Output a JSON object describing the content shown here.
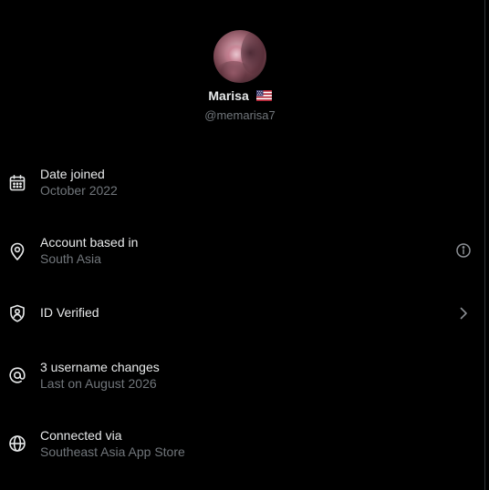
{
  "profile": {
    "name": "Marisa",
    "flag_emoji": "🇺🇸",
    "handle": "@memarisa7"
  },
  "rows": [
    {
      "title": "Date joined",
      "subtitle": "October 2022",
      "icon": "calendar-icon"
    },
    {
      "title": "Account based in",
      "subtitle": "South Asia",
      "icon": "location-pin-icon",
      "right_icon": "info-icon"
    },
    {
      "title": "ID Verified",
      "icon": "shield-user-icon",
      "right_icon": "chevron-right-icon"
    },
    {
      "title": "3 username changes",
      "subtitle": "Last on August 2026",
      "icon": "at-sign-icon"
    },
    {
      "title": "Connected via",
      "subtitle": "Southeast Asia App Store",
      "icon": "globe-icon"
    }
  ],
  "colors": {
    "background": "#000000",
    "primary_text": "#e7e9ea",
    "secondary_text": "#71767b",
    "divider": "#2f3336"
  }
}
